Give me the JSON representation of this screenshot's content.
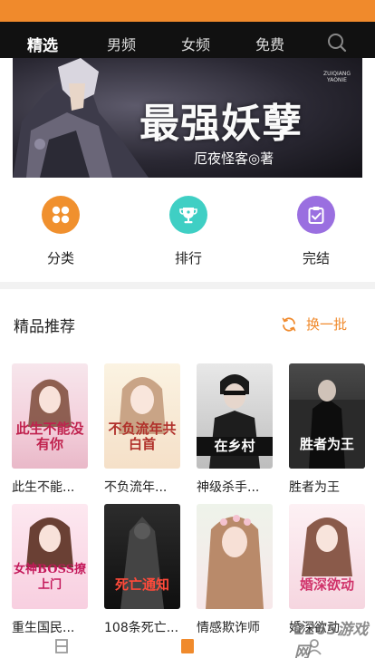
{
  "colors": {
    "accent": "#f08a2c",
    "nav_bg": "#111111"
  },
  "top_nav": {
    "tabs": [
      "精选",
      "男频",
      "女频",
      "免费"
    ],
    "active_tab": "精选",
    "search_icon": "search-icon"
  },
  "banner": {
    "title": "最强妖孽",
    "author": "厄夜怪客◎著",
    "pinyin": "ZUIQIANG YAONIE"
  },
  "shortcuts": [
    {
      "label": "分类",
      "icon": "grid-icon",
      "color": "#f0902e"
    },
    {
      "label": "排行",
      "icon": "trophy-icon",
      "color": "#3fcfc4"
    },
    {
      "label": "完结",
      "icon": "clipboard-check-icon",
      "color": "#9a6fe0"
    }
  ],
  "section": {
    "title": "精品推荐",
    "refresh_label": "换一批"
  },
  "books": [
    {
      "title": "此生不能...",
      "cover_text": "此生不能没有你"
    },
    {
      "title": "不负流年...",
      "cover_text": "不负流年共白首"
    },
    {
      "title": "神级杀手...",
      "cover_text": "在乡村"
    },
    {
      "title": "胜者为王",
      "cover_text": "胜者为王"
    },
    {
      "title": "重生国民...",
      "cover_text": "女神BOSS撩上门"
    },
    {
      "title": "108条死亡...",
      "cover_text": "死亡通知"
    },
    {
      "title": "情感欺诈师",
      "cover_text": ""
    },
    {
      "title": "婚深欲动",
      "cover_text": "婚深欲动"
    }
  ],
  "watermark": "2265游戏网"
}
